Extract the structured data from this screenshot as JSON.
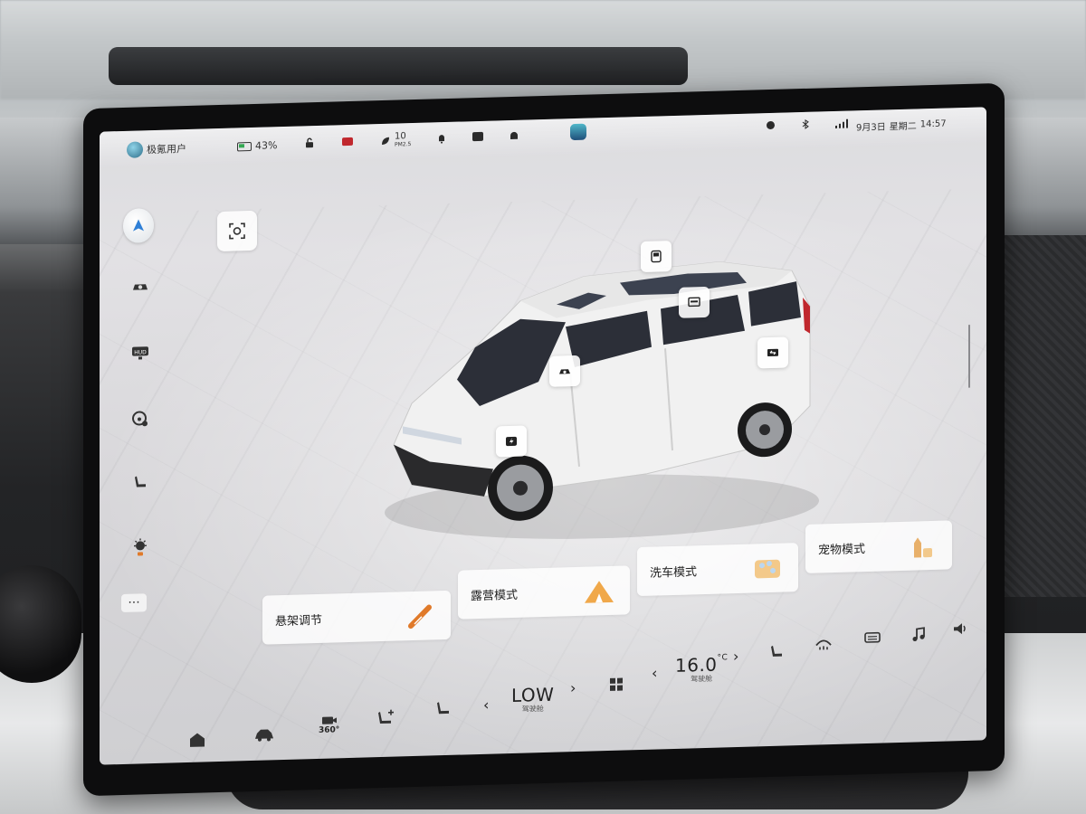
{
  "statusbar": {
    "user_name": "极氪用户",
    "battery_percent": "43%",
    "pm25_value": "10",
    "pm25_label": "PM2.5",
    "date": "9月3日",
    "weekday": "星期二",
    "time": "14:57"
  },
  "leftbar": {
    "items": [
      {
        "icon": "navigation-arrow-icon"
      },
      {
        "icon": "car-camera-icon"
      },
      {
        "icon": "hud-icon",
        "label": "HUD"
      },
      {
        "icon": "steering-wheel-icon"
      },
      {
        "icon": "seat-icon"
      },
      {
        "icon": "light-icon"
      },
      {
        "icon": "more-icon",
        "label": "···"
      }
    ]
  },
  "hotspots": [
    {
      "icon": "sunroof-icon"
    },
    {
      "icon": "rear-screen-icon"
    },
    {
      "icon": "door-icon"
    },
    {
      "icon": "mirror-camera-icon"
    },
    {
      "icon": "charge-port-icon"
    }
  ],
  "mode_cards": [
    {
      "label": "悬架调节",
      "icon": "suspension-icon"
    },
    {
      "label": "露营模式",
      "icon": "camping-tent-icon"
    },
    {
      "label": "洗车模式",
      "icon": "car-wash-icon"
    },
    {
      "label": "宠物模式",
      "icon": "pet-mode-icon"
    }
  ],
  "dock": {
    "fan_value": "LOW",
    "fan_label": "驾驶舱",
    "temp_value": "16.0",
    "temp_unit": "°C",
    "temp_label": "驾驶舱",
    "cam360_label": "360°",
    "chev_left": "‹",
    "chev_right": "›"
  },
  "colors": {
    "accent_blue": "#2f7fd6",
    "battery_green": "#34a853",
    "tail_red": "#c0272d"
  }
}
